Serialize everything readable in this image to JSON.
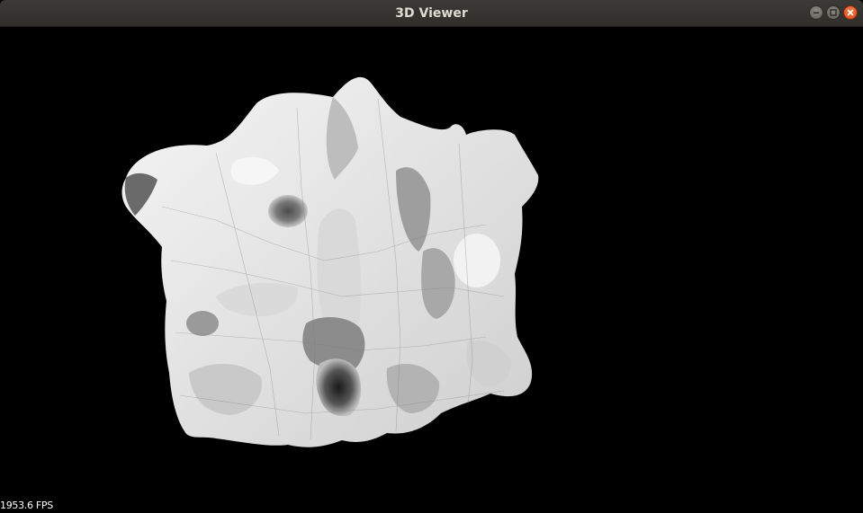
{
  "window": {
    "title": "3D Viewer"
  },
  "viewport": {
    "background": "#000000",
    "model_color": "#e8e8e8"
  },
  "status": {
    "fps": "1953.6 FPS"
  },
  "icons": {
    "minimize": "minimize-icon",
    "maximize": "maximize-icon",
    "close": "close-icon"
  }
}
